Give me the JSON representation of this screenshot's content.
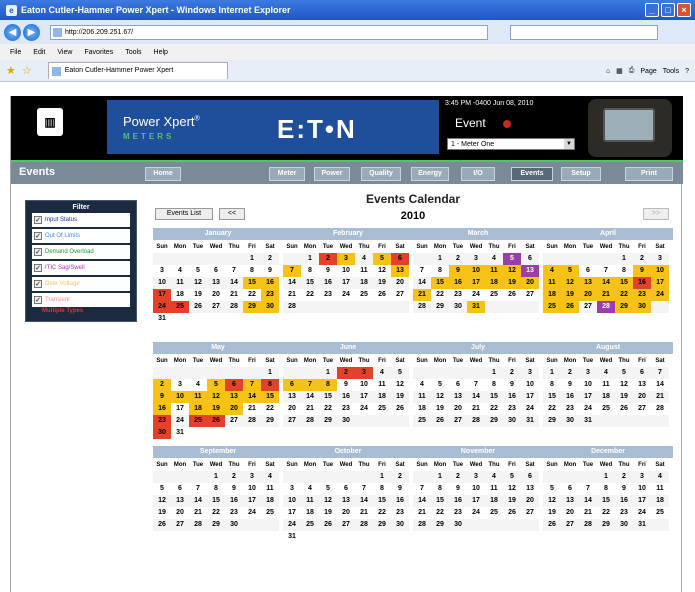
{
  "window": {
    "title": "Eaton Cutler-Hammer Power Xpert - Windows Internet Explorer"
  },
  "address": {
    "url": "http://206.209.251.67/"
  },
  "menu": [
    "File",
    "Edit",
    "View",
    "Favorites",
    "Tools",
    "Help"
  ],
  "tab": {
    "label": "Eaton Cutler-Hammer Power Xpert"
  },
  "toolbar": {
    "page": "Page",
    "tools": "Tools"
  },
  "header": {
    "product": "Power Xpert",
    "product_sup": "®",
    "sub": "METERS",
    "brand": "E:T•N",
    "time": "3:45 PM -0400   Jun 08, 2010",
    "event_label": "Event",
    "meter_select": "1 - Meter One"
  },
  "nav": {
    "title": "Events",
    "buttons": [
      "Home",
      "Meter",
      "Power",
      "Quality",
      "Energy",
      "I/O",
      "Events",
      "Setup",
      "Print"
    ],
    "active": "Events"
  },
  "filter": {
    "title": "Filter",
    "items": [
      {
        "label": "Input Status",
        "color": "#1a2fa0"
      },
      {
        "label": "Out Of Limits",
        "color": "#3b8be0"
      },
      {
        "label": "Demand Overload",
        "color": "#1d9a2a"
      },
      {
        "label": "ITIC Sag/Swell",
        "color": "#b02fb8"
      },
      {
        "label": "Over Voltage",
        "color": "#f0c060"
      },
      {
        "label": "Transient",
        "color": "#f09090"
      }
    ],
    "multi": "Multiple Types"
  },
  "calendar": {
    "title": "Events Calendar",
    "year": "2010",
    "events_list": "Events List",
    "prev": "<<",
    "next": ">>",
    "days": [
      "Sun",
      "Mon",
      "Tue",
      "Wed",
      "Thu",
      "Fri",
      "Sat"
    ],
    "months": [
      {
        "name": "January",
        "start": 5,
        "len": 31,
        "marks": {
          "15": "y",
          "16": "y",
          "17": "r",
          "23": "y",
          "24": "r",
          "25": "r",
          "29": "y",
          "30": "y"
        }
      },
      {
        "name": "February",
        "start": 1,
        "len": 28,
        "marks": {
          "2": "r",
          "3": "y",
          "5": "y",
          "6": "r",
          "7": "y",
          "13": "y"
        }
      },
      {
        "name": "March",
        "start": 1,
        "len": 31,
        "marks": {
          "5": "p",
          "9": "y",
          "10": "y",
          "11": "y",
          "12": "y",
          "13": "p",
          "15": "y",
          "16": "y",
          "17": "y",
          "18": "y",
          "19": "y",
          "20": "y",
          "21": "y",
          "31": "y"
        }
      },
      {
        "name": "April",
        "start": 4,
        "len": 30,
        "marks": {
          "4": "y",
          "5": "y",
          "9": "y",
          "10": "y",
          "11": "y",
          "12": "y",
          "13": "y",
          "14": "y",
          "15": "y",
          "16": "r",
          "17": "y",
          "18": "y",
          "19": "y",
          "20": "y",
          "21": "y",
          "22": "y",
          "23": "y",
          "24": "y",
          "25": "y",
          "26": "y",
          "28": "p",
          "29": "y",
          "30": "y"
        }
      },
      {
        "name": "May",
        "start": 6,
        "len": 31,
        "marks": {
          "2": "y",
          "5": "y",
          "6": "r",
          "7": "y",
          "8": "r",
          "9": "y",
          "10": "y",
          "11": "y",
          "12": "y",
          "13": "y",
          "14": "y",
          "15": "y",
          "16": "y",
          "18": "y",
          "19": "y",
          "20": "y",
          "23": "r",
          "25": "r",
          "26": "r",
          "30": "r"
        }
      },
      {
        "name": "June",
        "start": 2,
        "len": 30,
        "marks": {
          "2": "r",
          "3": "r",
          "6": "y",
          "7": "y",
          "8": "y"
        }
      },
      {
        "name": "July",
        "start": 4,
        "len": 31,
        "marks": {}
      },
      {
        "name": "August",
        "start": 0,
        "len": 31,
        "marks": {}
      },
      {
        "name": "September",
        "start": 3,
        "len": 30,
        "marks": {}
      },
      {
        "name": "October",
        "start": 5,
        "len": 31,
        "marks": {}
      },
      {
        "name": "November",
        "start": 1,
        "len": 30,
        "marks": {}
      },
      {
        "name": "December",
        "start": 3,
        "len": 31,
        "marks": {}
      }
    ]
  }
}
